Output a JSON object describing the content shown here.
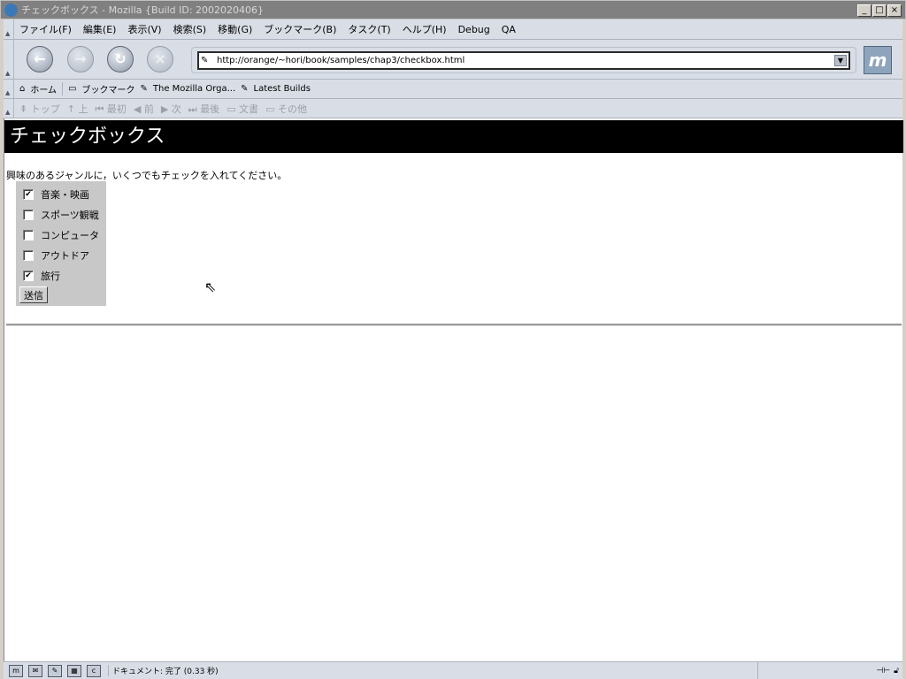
{
  "window": {
    "title": "チェックボックス - Mozilla {Build ID: 2002020406}",
    "controls": [
      "_",
      "□",
      "×"
    ]
  },
  "menu": [
    "ファイル(F)",
    "編集(E)",
    "表示(V)",
    "検索(S)",
    "移動(G)",
    "ブックマーク(B)",
    "タスク(T)",
    "ヘルプ(H)",
    "Debug",
    "QA"
  ],
  "nav": {
    "back": "←",
    "forward": "→",
    "reload": "↻",
    "stop": "×",
    "url": "http://orange/~hori/book/samples/chap3/checkbox.html",
    "logo": "m"
  },
  "personal": [
    "ホーム",
    "ブックマーク",
    "The Mozilla Orga...",
    "Latest Builds"
  ],
  "sitenav": [
    "トップ",
    "上",
    "最初",
    "前",
    "次",
    "最後",
    "文書",
    "その他"
  ],
  "page": {
    "heading": "チェックボックス",
    "intro": "興味のあるジャンルに，いくつでもチェックを入れてください。",
    "options": [
      {
        "label": "音楽・映画",
        "checked": true
      },
      {
        "label": "スポーツ観戦",
        "checked": false
      },
      {
        "label": "コンピュータ",
        "checked": false
      },
      {
        "label": "アウトドア",
        "checked": false
      },
      {
        "label": "旅行",
        "checked": true
      }
    ],
    "submit": "送信"
  },
  "status": {
    "text": "ドキュメント: 完了 (0.33 秒)"
  }
}
